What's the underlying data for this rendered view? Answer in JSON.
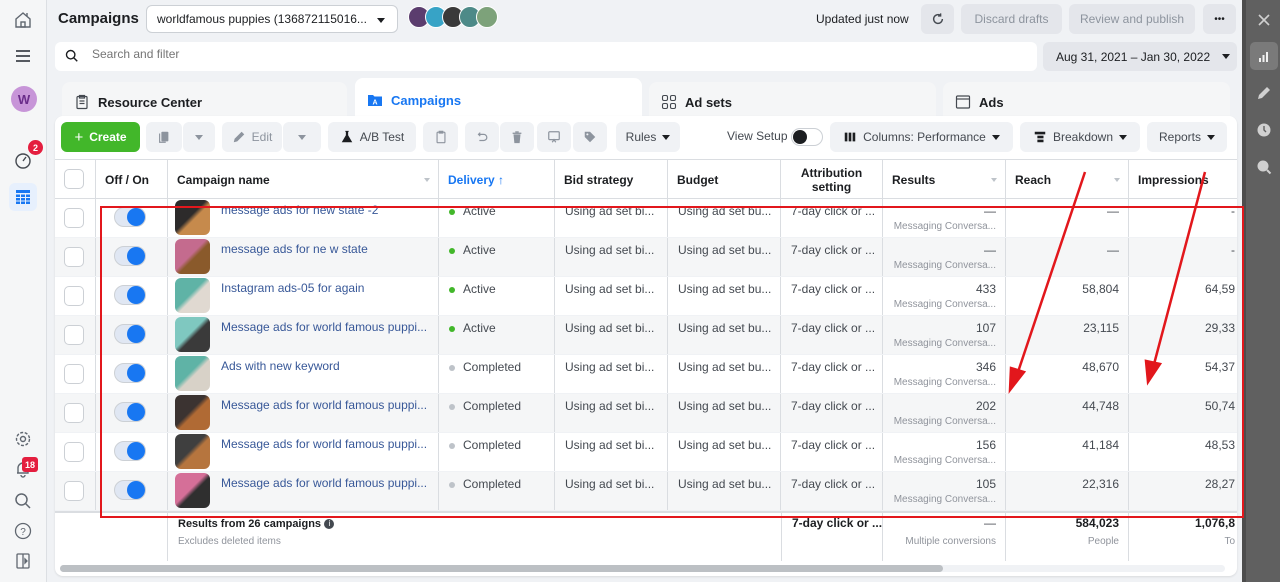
{
  "app": {
    "page_title": "Campaigns",
    "account_selector": "worldfamous puppies (136872115016...",
    "updated_status": "Updated just now",
    "discard_drafts": "Discard drafts",
    "review_publish": "Review and publish",
    "more": "•••"
  },
  "search": {
    "placeholder": "Search and filter",
    "value": ""
  },
  "date_range": "Aug 31, 2021 – Jan 30, 2022",
  "leftnav": {
    "avatar_letter": "W",
    "performance_badge": "2",
    "notifications_badge": "18"
  },
  "tabs": [
    {
      "label": "Resource Center"
    },
    {
      "label": "Campaigns",
      "active": true
    },
    {
      "label": "Ad sets"
    },
    {
      "label": "Ads"
    }
  ],
  "toolbar": {
    "create": "Create",
    "edit": "Edit",
    "ab_test": "A/B Test",
    "rules": "Rules",
    "view_setup": "View Setup",
    "columns": "Columns: Performance",
    "breakdown": "Breakdown",
    "reports": "Reports"
  },
  "columns": {
    "off_on": "Off / On",
    "campaign_name": "Campaign name",
    "delivery": "Delivery",
    "delivery_sort": "↑",
    "bid_strategy": "Bid strategy",
    "budget": "Budget",
    "attribution": "Attribution setting",
    "results": "Results",
    "reach": "Reach",
    "impressions": "Impressions"
  },
  "rows": [
    {
      "name": "message ads for new state -2",
      "delivery": "Active",
      "status_color": "#42b72a",
      "bid": "Using ad set bi...",
      "budget": "Using ad set bu...",
      "attribution": "7-day click or ...",
      "results": "—",
      "results_type": "Messaging Conversa...",
      "reach": "—",
      "impressions": "-"
    },
    {
      "name": "message ads for ne w state",
      "delivery": "Active",
      "status_color": "#42b72a",
      "bid": "Using ad set bi...",
      "budget": "Using ad set bu...",
      "attribution": "7-day click or ...",
      "results": "—",
      "results_type": "Messaging Conversa...",
      "reach": "—",
      "impressions": "-"
    },
    {
      "name": "Instagram ads-05 for again",
      "delivery": "Active",
      "status_color": "#42b72a",
      "bid": "Using ad set bi...",
      "budget": "Using ad set bu...",
      "attribution": "7-day click or ...",
      "results": "433",
      "results_type": "Messaging Conversa...",
      "reach": "58,804",
      "impressions": "64,59"
    },
    {
      "name": "Message ads for world famous puppi...",
      "delivery": "Active",
      "status_color": "#42b72a",
      "bid": "Using ad set bi...",
      "budget": "Using ad set bu...",
      "attribution": "7-day click or ...",
      "results": "107",
      "results_type": "Messaging Conversa...",
      "reach": "23,115",
      "impressions": "29,33"
    },
    {
      "name": "Ads with new keyword",
      "delivery": "Completed",
      "status_color": "#bec3c9",
      "bid": "Using ad set bi...",
      "budget": "Using ad set bu...",
      "attribution": "7-day click or ...",
      "results": "346",
      "results_type": "Messaging Conversa...",
      "reach": "48,670",
      "impressions": "54,37"
    },
    {
      "name": "Message ads for world famous puppi...",
      "delivery": "Completed",
      "status_color": "#bec3c9",
      "bid": "Using ad set bi...",
      "budget": "Using ad set bu...",
      "attribution": "7-day click or ...",
      "results": "202",
      "results_type": "Messaging Conversa...",
      "reach": "44,748",
      "impressions": "50,74"
    },
    {
      "name": "Message ads for world famous puppi...",
      "delivery": "Completed",
      "status_color": "#bec3c9",
      "bid": "Using ad set bi...",
      "budget": "Using ad set bu...",
      "attribution": "7-day click or ...",
      "results": "156",
      "results_type": "Messaging Conversa...",
      "reach": "41,184",
      "impressions": "48,53"
    },
    {
      "name": "Message ads for world famous puppi...",
      "delivery": "Completed",
      "status_color": "#bec3c9",
      "bid": "Using ad set bi...",
      "budget": "Using ad set bu...",
      "attribution": "7-day click or ...",
      "results": "105",
      "results_type": "Messaging Conversa...",
      "reach": "22,316",
      "impressions": "28,27"
    }
  ],
  "summary": {
    "title": "Results from 26 campaigns",
    "subtitle": "Excludes deleted items",
    "attribution": "7-day click or ...",
    "results": "—",
    "results_type": "Multiple conversions",
    "reach": "584,023",
    "reach_unit": "People",
    "impressions": "1,076,8",
    "impressions_unit": "To"
  },
  "colors": {
    "accent": "#1877f2",
    "create": "#42b72a",
    "annotation": "#e2171c",
    "active_dot": "#42b72a",
    "completed_dot": "#bec3c9"
  }
}
